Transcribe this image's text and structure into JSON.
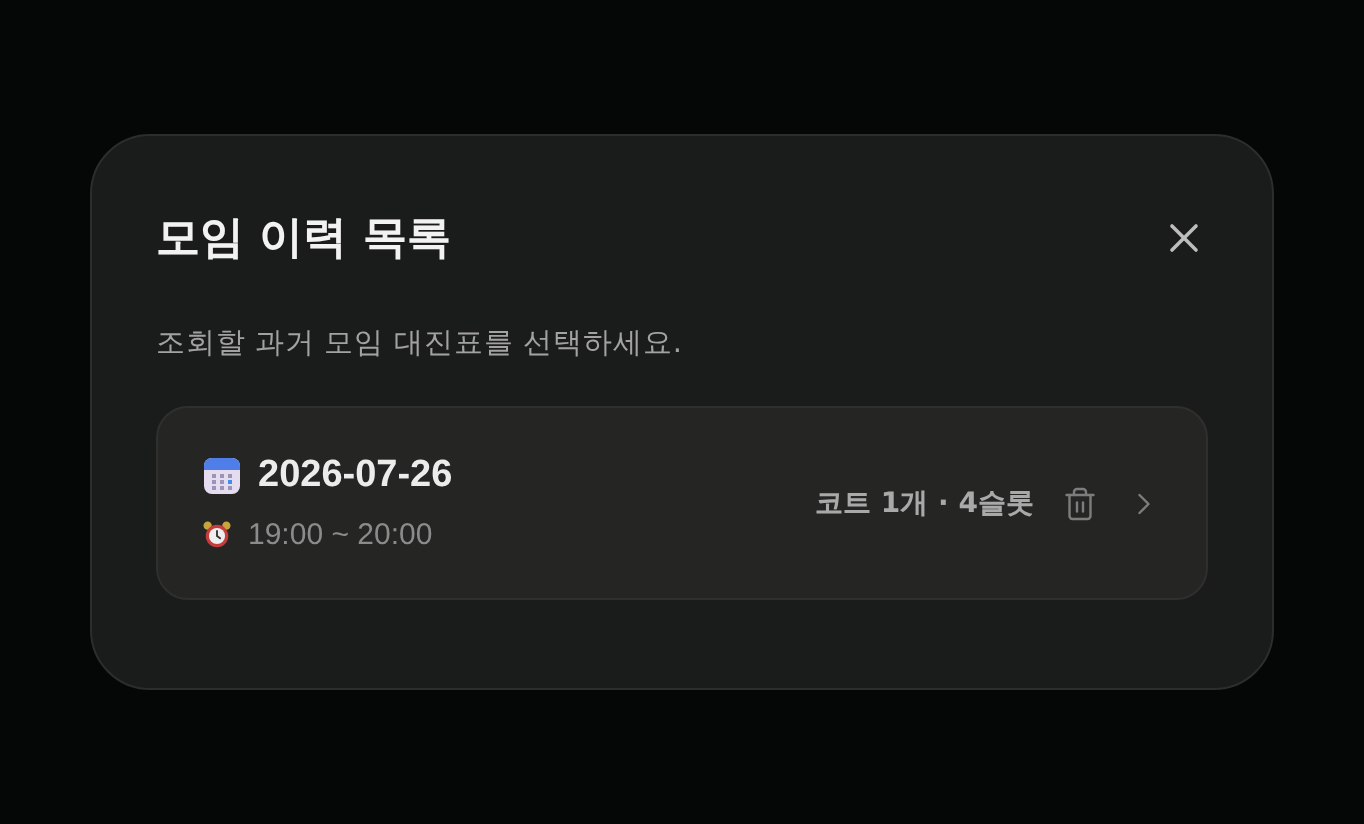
{
  "dialog": {
    "title": "모임 이력 목록",
    "description": "조회할 과거 모임 대진표를 선택하세요.",
    "sessions": [
      {
        "date": "2026-07-26",
        "time": "19:00 ~ 20:00",
        "summary": "코트 1개 · 4슬롯"
      }
    ]
  }
}
